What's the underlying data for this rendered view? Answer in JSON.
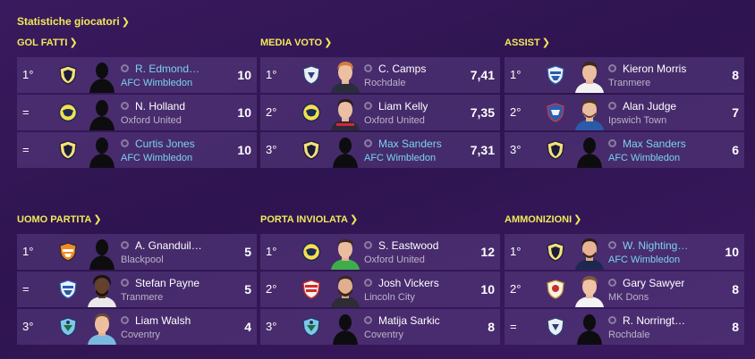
{
  "header": {
    "title": "Statistiche giocatori"
  },
  "panels": {
    "gol": {
      "title": "GOL FATTI",
      "rows": [
        {
          "rank": "1°",
          "name": "R. Edmond…",
          "club": "AFC Wimbledon",
          "value": "10"
        },
        {
          "rank": "=",
          "name": "N. Holland",
          "club": "Oxford United",
          "value": "10"
        },
        {
          "rank": "=",
          "name": "Curtis Jones",
          "club": "AFC Wimbledon",
          "value": "10"
        }
      ]
    },
    "media": {
      "title": "MEDIA VOTO",
      "rows": [
        {
          "rank": "1°",
          "name": "C. Camps",
          "club": "Rochdale",
          "value": "7,41"
        },
        {
          "rank": "2°",
          "name": "Liam Kelly",
          "club": "Oxford United",
          "value": "7,35"
        },
        {
          "rank": "3°",
          "name": "Max Sanders",
          "club": "AFC Wimbledon",
          "value": "7,31"
        }
      ]
    },
    "assist": {
      "title": "ASSIST",
      "rows": [
        {
          "rank": "1°",
          "name": "Kieron Morris",
          "club": "Tranmere",
          "value": "8"
        },
        {
          "rank": "2°",
          "name": "Alan Judge",
          "club": "Ipswich Town",
          "value": "7"
        },
        {
          "rank": "3°",
          "name": "Max Sanders",
          "club": "AFC Wimbledon",
          "value": "6"
        }
      ]
    },
    "uomo": {
      "title": "UOMO PARTITA",
      "rows": [
        {
          "rank": "1°",
          "name": "A. Gnanduil…",
          "club": "Blackpool",
          "value": "5"
        },
        {
          "rank": "=",
          "name": "Stefan Payne",
          "club": "Tranmere",
          "value": "5"
        },
        {
          "rank": "3°",
          "name": "Liam Walsh",
          "club": "Coventry",
          "value": "4"
        }
      ]
    },
    "porta": {
      "title": "PORTA INVIOLATA",
      "rows": [
        {
          "rank": "1°",
          "name": "S. Eastwood",
          "club": "Oxford United",
          "value": "12"
        },
        {
          "rank": "2°",
          "name": "Josh Vickers",
          "club": "Lincoln City",
          "value": "10"
        },
        {
          "rank": "3°",
          "name": "Matija Sarkic",
          "club": "Coventry",
          "value": "8"
        }
      ]
    },
    "ammo": {
      "title": "AMMONIZIONI",
      "rows": [
        {
          "rank": "1°",
          "name": "W. Nighting…",
          "club": "AFC Wimbledon",
          "value": "10"
        },
        {
          "rank": "2°",
          "name": "Gary Sawyer",
          "club": "MK Dons",
          "value": "8"
        },
        {
          "rank": "=",
          "name": "R. Norringt…",
          "club": "Rochdale",
          "value": "8"
        }
      ]
    }
  },
  "colors": {
    "accent": "#f2e95a",
    "highlight": "#7ad3f0",
    "row_bg": "#4e3373"
  }
}
